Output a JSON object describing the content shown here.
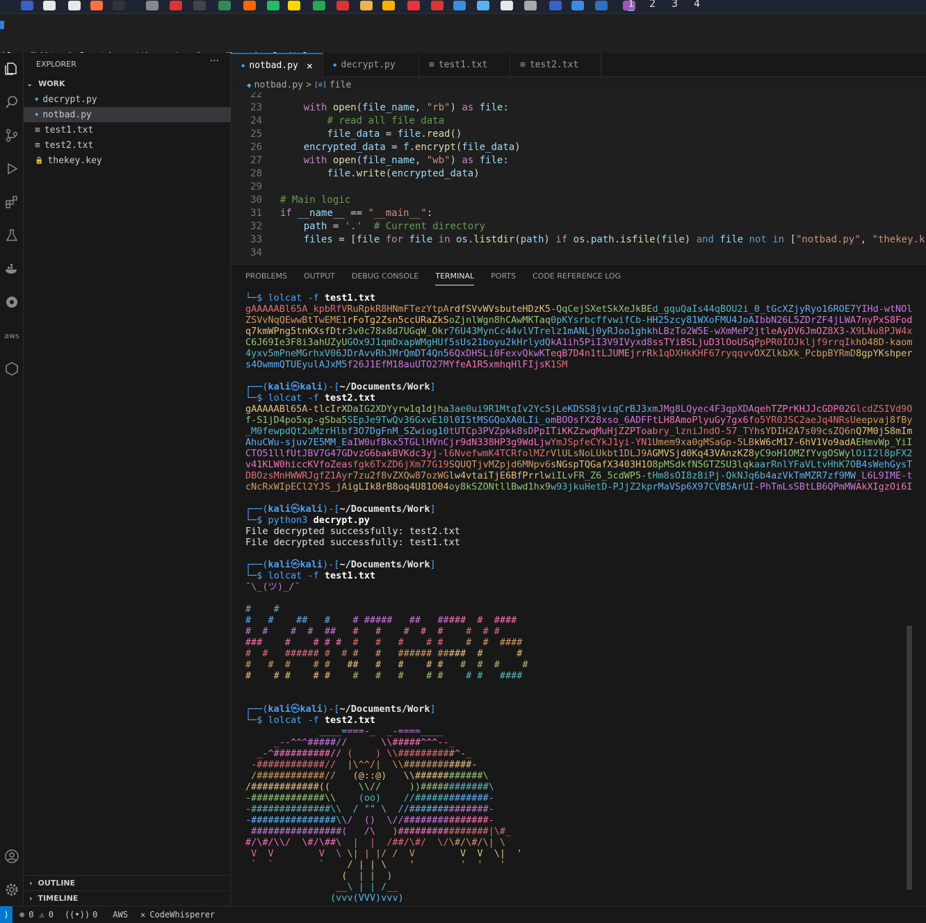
{
  "taskbar": {
    "workspaces": [
      "1",
      "2",
      "3",
      "4"
    ],
    "icon_colors": [
      "#3a5fc8",
      "#e8e8e8",
      "#e8e8e8",
      "#ff7139",
      "#333333",
      "#888888",
      "#d33",
      "#444",
      "#2e8b57",
      "#ff6600",
      "#2b6",
      "#ffd700",
      "#2a5",
      "#d33",
      "#e9b44c",
      "#ffb000",
      "#e33",
      "#d33",
      "#3a8de0",
      "#5ab1f0",
      "#e8e8e8",
      "#aaa",
      "#3a5fc8",
      "#3a8de0",
      "#2f6fc4",
      "#9b59b6",
      "#2e8bd8"
    ]
  },
  "menu": [
    "File",
    "Edit",
    "Selection",
    "View",
    "Go",
    "Run",
    "Terminal",
    "Help"
  ],
  "menu_first_visible": "ile",
  "explorer": {
    "title": "EXPLORER",
    "more": "···",
    "folder": "WORK",
    "files": [
      {
        "name": "decrypt.py",
        "icon": "python-icon",
        "selected": false
      },
      {
        "name": "notbad.py",
        "icon": "python-icon",
        "selected": true
      },
      {
        "name": "test1.txt",
        "icon": "text-file-icon",
        "selected": false
      },
      {
        "name": "test2.txt",
        "icon": "text-file-icon",
        "selected": false
      },
      {
        "name": "thekey.key",
        "icon": "lock-icon",
        "selected": false
      }
    ],
    "outline": "OUTLINE",
    "timeline": "TIMELINE"
  },
  "tabs": [
    {
      "label": "notbad.py",
      "active": true,
      "close": "×"
    },
    {
      "label": "decrypt.py",
      "active": false
    },
    {
      "label": "test1.txt",
      "active": false
    },
    {
      "label": "test2.txt",
      "active": false
    }
  ],
  "breadcrumb": {
    "file": "notbad.py",
    "symbol": "file",
    "sep": ">"
  },
  "editor": {
    "lines": [
      {
        "n": "22",
        "html": ""
      },
      {
        "n": "23",
        "html": "    <span class='kw'>with</span> <span class='fn'>open</span>(<span class='var'>file_name</span>, <span class='str'>\"rb\"</span>) <span class='kw'>as</span> <span class='var'>file</span>:"
      },
      {
        "n": "24",
        "html": "        <span class='cm'># read all file data</span>"
      },
      {
        "n": "25",
        "html": "        <span class='var'>file_data</span> = <span class='var'>file</span>.<span class='fn'>read</span>()"
      },
      {
        "n": "26",
        "html": "    <span class='var'>encrypted_data</span> = <span class='var'>f</span>.<span class='fn'>encrypt</span>(<span class='var'>file_data</span>)"
      },
      {
        "n": "27",
        "html": "    <span class='kw'>with</span> <span class='fn'>open</span>(<span class='var'>file_name</span>, <span class='str'>\"wb\"</span>) <span class='kw'>as</span> <span class='var'>file</span>:"
      },
      {
        "n": "28",
        "html": "        <span class='var'>file</span>.<span class='fn'>write</span>(<span class='var'>encrypted_data</span>)"
      },
      {
        "n": "29",
        "html": ""
      },
      {
        "n": "30",
        "html": "<span class='cm'># Main logic</span>"
      },
      {
        "n": "31",
        "html": "<span class='kw'>if</span> <span class='var'>__name__</span> == <span class='str'>\"__main__\"</span>:"
      },
      {
        "n": "32",
        "html": "    <span class='var'>path</span> = <span class='str'>'.'</span>  <span class='cm'># Current directory</span>"
      },
      {
        "n": "33",
        "html": "    <span class='var'>files</span> = [<span class='var'>file</span> <span class='kw'>for</span> <span class='var'>file</span> <span class='kw'>in</span> <span class='var'>os</span>.<span class='fn'>listdir</span>(<span class='var'>path</span>) <span class='kw'>if</span> <span class='var'>os</span>.<span class='var'>path</span>.<span class='fn'>isfile</span>(<span class='var'>file</span>) <span class='kw2'>and</span> <span class='var'>file</span> <span class='kw2'>not in</span> [<span class='str'>\"notbad.py\"</span>, <span class='str'>\"thekey.k</span>"
      },
      {
        "n": "34",
        "html": ""
      }
    ]
  },
  "panel_tabs": [
    "PROBLEMS",
    "OUTPUT",
    "DEBUG CONSOLE",
    "TERMINAL",
    "PORTS",
    "CODE REFERENCE LOG"
  ],
  "terminal": {
    "prompt_user": "kali",
    "prompt_host": "kali",
    "prompt_dir": "~/Documents/Work",
    "blocks": [
      {
        "cmd": "lolcat",
        "flag": "-f",
        "arg": "test1.txt",
        "start": 0,
        "show_header": false
      },
      {
        "cmd": "lolcat",
        "flag": "-f",
        "arg": "test2.txt",
        "start": 8,
        "show_header": true
      },
      {
        "cmd": "python3",
        "flag": "",
        "arg": "decrypt.py",
        "start": 19,
        "show_header": true
      },
      {
        "cmd": "lolcat",
        "flag": "-f",
        "arg": "test1.txt",
        "start": 24,
        "show_header": true
      },
      {
        "cmd": "lolcat",
        "flag": "-f",
        "arg": "test2.txt",
        "start": 37,
        "show_header": true
      }
    ],
    "test1_cipher": [
      "gAAAAABl65A_kpbRfVRuRpkR8HNmFTezYtpArdfSVvWVsbuteHDzK5-QqCejSXetSkXeJkBEd_gquQaIs44qBOU2i_0_tGcXZjyRyo16ROE7YIHd-wtNOlO",
      "ZSVvNqQEwwBtTwEME1rFoTg2Zsn5ccURaZkSoZjnlWgn8hCAwMKTaq0pKYsrbcffvwifCb-HH25zcy81WXoFMU4JoAIbbN26L5ZDrZF4jLWA7nyPxS8Fod9",
      "q7kmWPng5tnKXsfDtr3v0c78x8d7UGqW_Okr76U43MynCc44vlVTrelz1mANLj0yRJoo1ghkhLBzTo2W5E-wXmMeP2jtleAyDV6JmOZ8X3-X9LNu8PJW4xJ",
      "C6J69Ie3F8i3ahUZyUGOx9J1qmDxapWMgHUf5sUs21boyu2kHrlydQkA1ih5PiI3V9IVyxd8ssTYiBSLjuD3lOoUSqPpPR0IOJkljf9rrqIkhO48D-kaomz",
      "4yxv5mPneMGrhxV06JDrAvvRhJMrQmDT4Qn56QxDHSLi0FexvQkwKTeqB7D4n1tLJUMEjrrRk1qDXHkKHF67ryqqvvOXZlkbXk_PcbpBYRmD8gpYKshpern",
      "s4OwmmQTUEyulAJxM5f26J1EfM18auUTO27MYfeA1R5xmhqHlFIjsK1SM"
    ],
    "test2_cipher": [
      "gAAAAABl65A-tlcIrXDaIG2XDYyrw1q1djha3ae0ui9R1MtqIv2Yc5jLeKDSS8jviqCrBJ3xmJMg8LQyec4F3qpXDAqehTZPrKHJJcGDP02GlcdZSIVd9Oe",
      "f-S1jD4po5xp-gSba5SEpJe9TwQv36GxvE10l0I5tMSGQoXA0LIi_omBOOsfX28xso_6ADFFtLH8AmoPlyuGy7gx6fo5YR0JSC2aeJq4NRsUeepvaj8fByC",
      "_M0fewpdQt2uMzrHlbf3O7DgFnM_SZwiog10tUTCp3PVZpkk8sDPpITiKKZzwqMuHjZZPToabry_lzniJndO-57_TYhsYDIH2A7s09csZQ6nQ7M0jS8mImh",
      "AhuCWu-sjuv7E5MM_EaIW0ufBkx5TGLlHVnCjr9dN338HP3g9WdLjwYmJSpfeCYkJ1yi-YN1Umem9xa0gMSaGp-5LBkW6cM17-6hV1Vo9adAEHmvWp_YiIh",
      "CTO51llfUtJBV7G47GDvzG6bakBVKdc3yj-l6NvefwmK4TCRfolMZrVlULsNoLUkbt1DLJ9AGMVSjd0Kq43VAnzKZ8yC9oH1OMZfYvgOSWylOiI2l8pFX2R",
      "v41KLW0hiccKVfoZeasfgk6TxZD6jXm77G19SQUQTjvMZpjd6MNpv6sNGspTQGafX3403H1O8pMSdkfN5GTZSU3lqkaarRnlYFaVLtvHhK7OB4sWehGysTK",
      "DBOzsMnHWWRJgfZ1Ayr7zu2f8vZXQw87ozWGlw4vtaiTjE6BfPrrlwiILvFR_Z6_5cdWP5-tHm8sOI8zBiPj-QkNJq6b4azVkTmMZR7zf9MW_L6L9IME-tf",
      "cNcRxWIpECl2YJS_jAigLIk8rB8oq4U81O04oy8kSZONtllBwd1hx9w93jkuHetD-PJjZ2kprMaVSp6X97CVB5ArUI-PhTmLsSBtLB6QPmMWAkXIgzOi6I="
    ],
    "decrypt_output": [
      "File decrypted successfully: test2.txt",
      "File decrypted successfully: test1.txt"
    ],
    "shrug": "¯\\_(ツ)_/¯",
    "banner": [
      "#    #",
      "#   #    ##   #    # #####   ##   #####  #  ####",
      "#  #    #  #  ##   #   #    #  #  #    #  # #",
      "###    #    # # #  #   #   #    # #    #  #  ####",
      "#  #   ###### #  # #   #   ###### #####  #      #",
      "#   #  #    # #   ##   #   #    # #   #  #  #    #",
      "#    # #    # #    #   #   #    # #    # #   ####"
    ],
    "art": [
      "             ____====-_  _-====____",
      "     _--^^^#####//      \\\\#####^^^--_",
      "  _-^##########// (    ) \\\\##########^-_",
      " -############//  |\\^^/|  \\\\############-",
      " /############//   (@::@)   \\\\############\\",
      "/############((     \\\\//     ))############\\",
      "-#############\\\\    (oo)    //#############-",
      "-##############\\\\  / \"\" \\  //##############-",
      "-###############\\\\/  ()  \\//###############-",
      " ################(   /\\   )################|\\#_",
      "#/\\#/\\\\/  \\#/\\##\\  |  |  /##/\\#/  \\/\\#/\\#/\\| \\",
      " V  V        V  \\ \\| | |/ /  V        V  V  \\|  '",
      " `  `        `    / | | \\    '        '  '   '",
      "                 (  | |  )",
      "                __\\ | | /__",
      "               (vvv(VVV)vvv)"
    ]
  },
  "status": {
    "errors": "0",
    "warnings": "0",
    "ports": "0",
    "aws": "AWS",
    "codewhisperer": "CodeWhisperer"
  }
}
